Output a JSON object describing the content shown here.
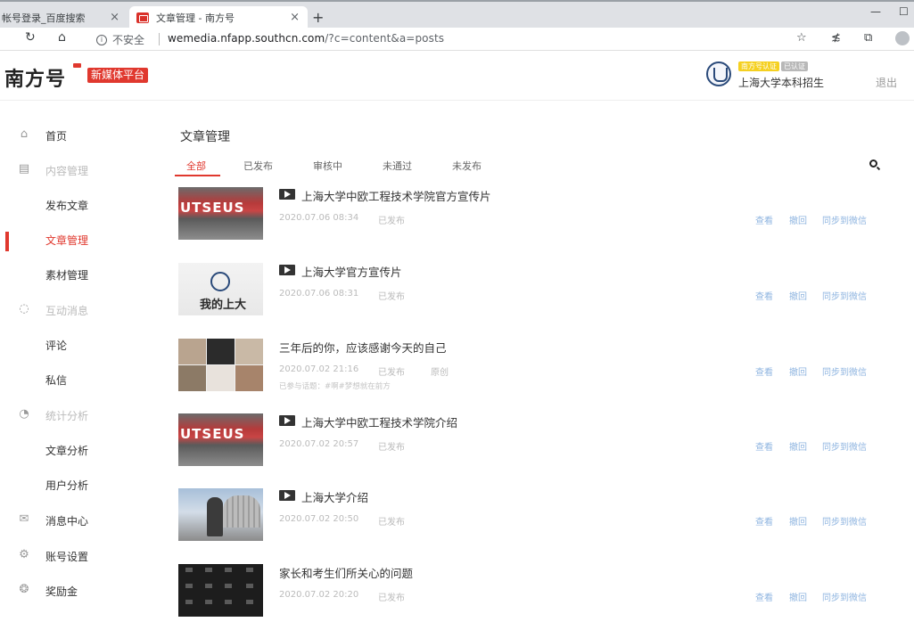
{
  "browser": {
    "tabs": [
      {
        "title": "帐号登录_百度搜索",
        "close": "×"
      },
      {
        "title": "文章管理 - 南方号",
        "close": "×"
      }
    ],
    "new_tab": "+",
    "window_controls": [
      "—",
      "☐"
    ],
    "security_label": "不安全",
    "url_host": "wemedia.nfapp.southcn.com",
    "url_path": "/?c=content&a=posts"
  },
  "header": {
    "logo_text": "南方号",
    "logo_badge": "新媒体平台",
    "badge_yellow": "南方号认证",
    "badge_gray": "已认证",
    "username": "上海大学本科招生",
    "logout": "退出"
  },
  "sidebar": {
    "items": [
      {
        "label": "首页",
        "icon": "home-icon",
        "glyph": "⌂",
        "type": "plain"
      },
      {
        "label": "内容管理",
        "icon": "content-icon",
        "glyph": "▤",
        "type": "group"
      },
      {
        "label": "发布文章",
        "type": "plain"
      },
      {
        "label": "文章管理",
        "type": "active"
      },
      {
        "label": "素材管理",
        "type": "plain"
      },
      {
        "label": "互动消息",
        "icon": "chat-icon",
        "glyph": "◌",
        "type": "group"
      },
      {
        "label": "评论",
        "type": "plain"
      },
      {
        "label": "私信",
        "type": "plain"
      },
      {
        "label": "统计分析",
        "icon": "stats-icon",
        "glyph": "◔",
        "type": "group"
      },
      {
        "label": "文章分析",
        "type": "plain"
      },
      {
        "label": "用户分析",
        "type": "plain"
      },
      {
        "label": "消息中心",
        "icon": "mail-icon",
        "glyph": "✉",
        "type": "plain"
      },
      {
        "label": "账号设置",
        "icon": "gear-icon",
        "glyph": "⚙",
        "type": "plain"
      },
      {
        "label": "奖励金",
        "icon": "reward-icon",
        "glyph": "❂",
        "type": "plain"
      }
    ]
  },
  "main": {
    "title": "文章管理",
    "tabs": [
      "全部",
      "已发布",
      "审核中",
      "未通过",
      "未发布"
    ],
    "actions": {
      "view": "查看",
      "withdraw": "撤回",
      "sync": "同步到微信"
    },
    "posts": [
      {
        "title": "上海大学中欧工程技术学院官方宣传片",
        "video": true,
        "date": "2020.07.06 08:34",
        "status": "已发布",
        "thumb": "UTSEUS"
      },
      {
        "title": "上海大学官方宣传片",
        "video": true,
        "date": "2020.07.06 08:31",
        "status": "已发布",
        "thumb": "我的上大"
      },
      {
        "title": "三年后的你，应该感谢今天的自己",
        "video": false,
        "date": "2020.07.02 21:16",
        "status": "已发布",
        "orig": "原创",
        "extra": "已参与话题：#啊#梦想就在前方"
      },
      {
        "title": "上海大学中欧工程技术学院介绍",
        "video": true,
        "date": "2020.07.02 20:57",
        "status": "已发布",
        "thumb": "UTSEUS"
      },
      {
        "title": "上海大学介绍",
        "video": true,
        "date": "2020.07.02 20:50",
        "status": "已发布"
      },
      {
        "title": "家长和考生们所关心的问题",
        "video": false,
        "date": "2020.07.02 20:20",
        "status": "已发布"
      }
    ]
  },
  "colors": {
    "accent": "#e0382e",
    "link": "#8fb5e0",
    "muted": "#bbbbbb"
  }
}
